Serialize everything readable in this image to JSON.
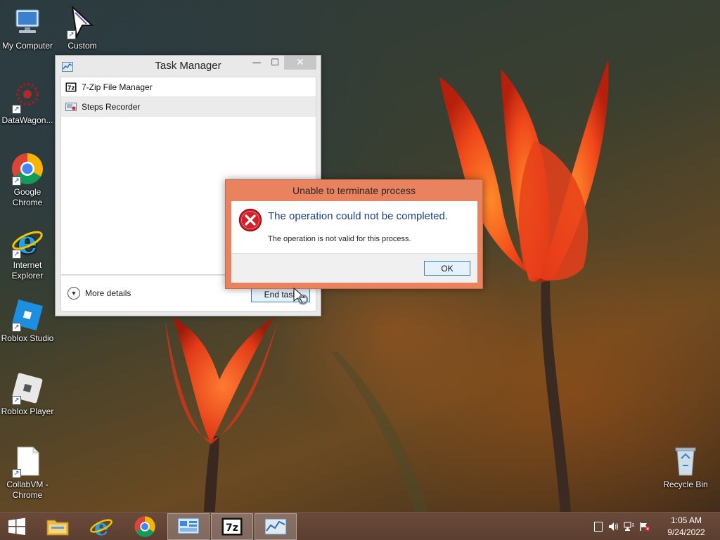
{
  "desktop": {
    "icons": [
      {
        "label": "My Computer",
        "icon": "computer-icon"
      },
      {
        "label": "Custom",
        "icon": "cursor-icon"
      },
      {
        "label": "DataWagon...",
        "icon": "datawagon-icon"
      },
      {
        "label": "Google Chrome",
        "icon": "chrome-icon"
      },
      {
        "label": "Internet Explorer",
        "icon": "ie-icon"
      },
      {
        "label": "Roblox Studio",
        "icon": "roblox-studio-icon"
      },
      {
        "label": "Roblox Player",
        "icon": "roblox-player-icon"
      },
      {
        "label": "CollabVM - Chrome",
        "icon": "file-icon"
      },
      {
        "label": "Recycle Bin",
        "icon": "recycle-bin-icon"
      }
    ]
  },
  "task_manager": {
    "title": "Task Manager",
    "minimize": "—",
    "maximize": "☐",
    "close": "✕",
    "processes": [
      {
        "name": "7-Zip File Manager",
        "icon": "7zip-icon"
      },
      {
        "name": "Steps Recorder",
        "icon": "steps-recorder-icon"
      }
    ],
    "more_details": "More details",
    "end_task": "End task"
  },
  "dialog": {
    "title": "Unable to terminate process",
    "main_instruction": "The operation could not be completed.",
    "content": "The operation is not valid for this process.",
    "ok": "OK"
  },
  "taskbar": {
    "items": [
      "start-icon",
      "file-explorer-icon",
      "internet-explorer-icon",
      "chrome-icon",
      "control-panel-icon",
      "7zip-icon",
      "task-manager-icon"
    ],
    "time": "1:05 AM",
    "date": "9/24/2022"
  },
  "colors": {
    "dialog_frame": "#e9835f",
    "main_instruction": "#1b3f8b",
    "error_red": "#d0202a"
  }
}
